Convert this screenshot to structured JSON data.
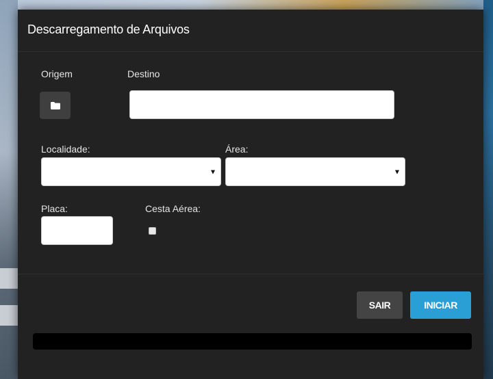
{
  "modal": {
    "title": "Descarregamento de Arquivos"
  },
  "form": {
    "origem_label": "Origem",
    "destino_label": "Destino",
    "destino_value": "",
    "localidade_label": "Localidade:",
    "localidade_value": "",
    "area_label": "Área:",
    "area_value": "",
    "placa_label": "Placa:",
    "placa_value": "",
    "cesta_aerea_label": "Cesta Aérea:",
    "cesta_aerea_checked": false
  },
  "footer": {
    "sair_label": "SAIR",
    "iniciar_label": "INICIAR"
  },
  "progress": {
    "value": 0
  },
  "colors": {
    "modal_bg": "#222222",
    "primary": "#2a9fd6",
    "secondary_button": "#444444",
    "progress_track": "#000000"
  },
  "icons": {
    "origem_button": "folder-icon"
  }
}
